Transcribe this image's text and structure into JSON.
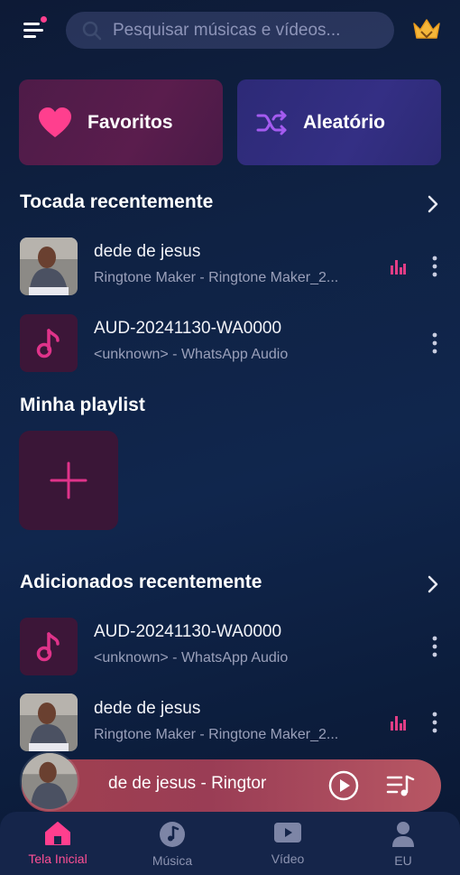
{
  "header": {
    "search_placeholder": "Pesquisar músicas e vídeos...",
    "menu_icon": "menu-icon",
    "premium_icon": "crown-icon"
  },
  "cards": {
    "favorites_label": "Favoritos",
    "shuffle_label": "Aleatório"
  },
  "recent_played": {
    "title": "Tocada recentemente",
    "items": [
      {
        "title": "dede de jesus",
        "subtitle": "Ringtone Maker - Ringtone Maker_2...",
        "playing": true
      },
      {
        "title": "AUD-20241130-WA0000",
        "subtitle": "<unknown> - WhatsApp Audio",
        "playing": false
      }
    ]
  },
  "playlist": {
    "title": "Minha playlist"
  },
  "recent_added": {
    "title": "Adicionados recentemente",
    "items": [
      {
        "title": "AUD-20241130-WA0000",
        "subtitle": "<unknown> - WhatsApp Audio",
        "playing": false
      },
      {
        "title": "dede de jesus",
        "subtitle": "Ringtone Maker - Ringtone Maker_2...",
        "playing": true
      }
    ]
  },
  "mini_player": {
    "title": "de de jesus - Ringtor"
  },
  "nav": {
    "items": [
      {
        "label": "Tela Inicial",
        "icon": "home-icon",
        "active": true
      },
      {
        "label": "Música",
        "icon": "music-disc-icon",
        "active": false
      },
      {
        "label": "Vídeo",
        "icon": "video-icon",
        "active": false
      },
      {
        "label": "EU",
        "icon": "person-icon",
        "active": false
      }
    ]
  },
  "colors": {
    "accent": "#ff3f8e",
    "background": "#0f2244",
    "favorites_card": "#541c4a",
    "shuffle_card": "#302d7e"
  }
}
